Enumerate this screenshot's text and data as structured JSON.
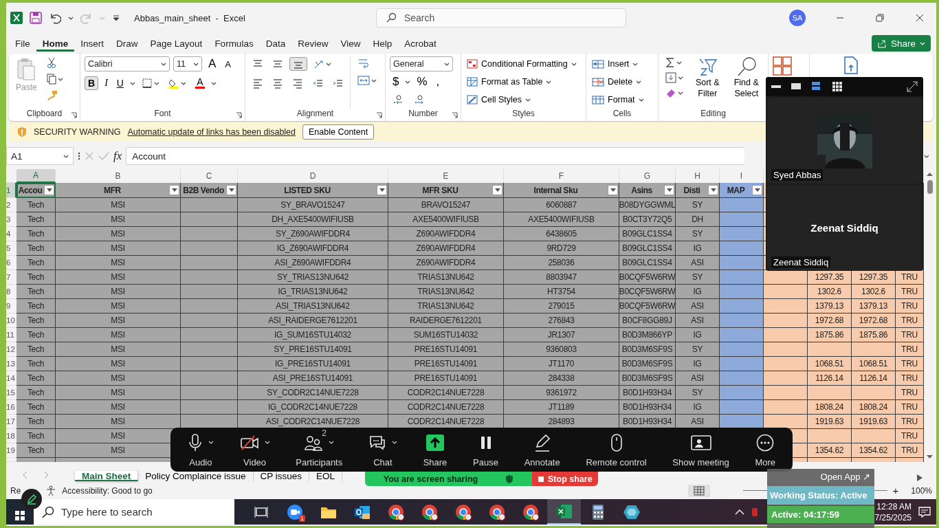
{
  "window": {
    "title": "Abbas_main_sheet  -  Excel",
    "search_placeholder": "Search",
    "user_initials": "SA"
  },
  "menu_tabs": [
    {
      "label": "File",
      "selected": false
    },
    {
      "label": "Home",
      "selected": true
    },
    {
      "label": "Insert",
      "selected": false
    },
    {
      "label": "Draw",
      "selected": false
    },
    {
      "label": "Page Layout",
      "selected": false
    },
    {
      "label": "Formulas",
      "selected": false
    },
    {
      "label": "Data",
      "selected": false
    },
    {
      "label": "Review",
      "selected": false
    },
    {
      "label": "View",
      "selected": false
    },
    {
      "label": "Help",
      "selected": false
    },
    {
      "label": "Acrobat",
      "selected": false
    }
  ],
  "share_button": {
    "label": "Share"
  },
  "ribbon": {
    "clipboard": {
      "label": "Clipboard",
      "paste": "Paste"
    },
    "font": {
      "label": "Font",
      "font_name": "Calibri",
      "font_size": "11",
      "grow": "A",
      "shrink": "A",
      "font_color": "A",
      "styles": [
        {
          "kind": "bold",
          "label": "B",
          "selected": true
        },
        {
          "kind": "italic",
          "label": "I",
          "selected": false
        },
        {
          "kind": "underline",
          "label": "U",
          "selected": false
        }
      ]
    },
    "alignment": {
      "label": "Alignment",
      "vertical": [
        {
          "kind": "top",
          "selected": false
        },
        {
          "kind": "middle",
          "selected": false
        },
        {
          "kind": "bottom",
          "selected": true
        }
      ]
    },
    "number": {
      "label": "Number",
      "format": "General",
      "symbols": [
        "$",
        "%",
        ","
      ]
    },
    "styles": {
      "label": "Styles",
      "items": [
        "Conditional Formatting",
        "Format as Table",
        "Cell Styles"
      ]
    },
    "cells": {
      "label": "Cells",
      "items": [
        "Insert",
        "Delete",
        "Format"
      ]
    },
    "editing": {
      "label": "Editing",
      "items": [
        "Sort & Filter",
        "Find & Select"
      ]
    }
  },
  "security_bar": {
    "title": "SECURITY WARNING",
    "message": "Automatic update of links has been disabled",
    "button": "Enable Content"
  },
  "formula_bar": {
    "cell_ref": "A1",
    "fx": "fx",
    "value": "Account"
  },
  "sheet": {
    "header_row": {
      "number": "1",
      "selected": true
    },
    "columns": [
      {
        "letter": "A",
        "header": "Accou",
        "color": "#a6a6a6",
        "filter": true,
        "selected": true
      },
      {
        "letter": "B",
        "header": "MFR",
        "color": "#a6a6a6",
        "filter": true,
        "selected": false
      },
      {
        "letter": "C",
        "header": "B2B Vendo",
        "color": "#a6a6a6",
        "filter": true,
        "selected": false
      },
      {
        "letter": "D",
        "header": "LISTED SKU",
        "color": "#a6a6a6",
        "filter": true,
        "selected": false
      },
      {
        "letter": "E",
        "header": "MFR SKU",
        "color": "#a6a6a6",
        "filter": true,
        "selected": false
      },
      {
        "letter": "F",
        "header": "Internal Sku",
        "color": "#a6a6a6",
        "filter": true,
        "selected": false
      },
      {
        "letter": "G",
        "header": "Asins",
        "color": "#a6a6a6",
        "filter": true,
        "selected": false
      },
      {
        "letter": "H",
        "header": "Disti",
        "color": "#a6a6a6",
        "filter": true,
        "selected": false
      },
      {
        "letter": "I",
        "header": "MAP",
        "color": "#8eaadb",
        "filter": true,
        "selected": false
      },
      {
        "color": "#f8cbad"
      },
      {
        "color": "#f8cbad"
      },
      {
        "color": "#f8cbad"
      },
      {
        "color": "#f8cbad"
      }
    ],
    "rows": [
      {
        "number": "2",
        "selected": false,
        "cells": [
          "Tech",
          "MSI",
          null,
          "SY_BRAVO15247",
          "BRAVO15247",
          "6060887",
          "B08DYGGWML",
          "SY",
          null,
          null,
          null,
          null,
          null
        ]
      },
      {
        "number": "3",
        "selected": false,
        "cells": [
          "Tech",
          "MSI",
          null,
          "DH_AXE5400WIFIUSB",
          "AXE5400WIFIUSB",
          "AXE5400WIFIUSB",
          "B0CT3Y72Q5",
          "DH",
          null,
          null,
          null,
          null,
          null
        ]
      },
      {
        "number": "4",
        "selected": false,
        "cells": [
          "Tech",
          "MSI",
          null,
          "SY_Z690AWIFDDR4",
          "Z690AWIFDDR4",
          "6438605",
          "B09GLC1SS4",
          "SY",
          null,
          null,
          null,
          null,
          null
        ]
      },
      {
        "number": "5",
        "selected": false,
        "cells": [
          "Tech",
          "MSI",
          null,
          "IG_Z690AWIFDDR4",
          "Z690AWIFDDR4",
          "9RD729",
          "B09GLC1SS4",
          "IG",
          null,
          null,
          null,
          null,
          null
        ]
      },
      {
        "number": "6",
        "selected": false,
        "cells": [
          "Tech",
          "MSI",
          null,
          "ASI_Z690AWIFDDR4",
          "Z690AWIFDDR4",
          "258036",
          "B09GLC1SS4",
          "ASI",
          null,
          null,
          null,
          null,
          null
        ]
      },
      {
        "number": "7",
        "selected": false,
        "cells": [
          "Tech",
          "MSI",
          null,
          "SY_TRIAS13NU642",
          "TRIAS13NU642",
          "8803947",
          "B0CQF5W6RW",
          "SY",
          null,
          null,
          "1297.35",
          "1297.35",
          "TRU"
        ]
      },
      {
        "number": "8",
        "selected": false,
        "cells": [
          "Tech",
          "MSI",
          null,
          "IG_TRIAS13NU642",
          "TRIAS13NU642",
          "HT3754",
          "B0CQF5W6RW",
          "IG",
          null,
          null,
          "1302.6",
          "1302.6",
          "TRU"
        ]
      },
      {
        "number": "9",
        "selected": false,
        "cells": [
          "Tech",
          "MSI",
          null,
          "ASI_TRIAS13NU642",
          "TRIAS13NU642",
          "279015",
          "B0CQF5W6RW",
          "ASI",
          null,
          null,
          "1379.13",
          "1379.13",
          "TRU"
        ]
      },
      {
        "number": "10",
        "selected": false,
        "cells": [
          "Tech",
          "MSI",
          null,
          "ASI_RAIDERGE7612201",
          "RAIDERGE7612201",
          "276843",
          "B0CF8GG89J",
          "ASI",
          null,
          null,
          "1972.68",
          "1972.68",
          "TRU"
        ]
      },
      {
        "number": "11",
        "selected": false,
        "cells": [
          "Tech",
          "MSI",
          null,
          "IG_SUM16STU14032",
          "SUM16STU14032",
          "JR1307",
          "B0D3M866YP",
          "IG",
          null,
          null,
          "1875.86",
          "1875.86",
          "TRU"
        ]
      },
      {
        "number": "12",
        "selected": false,
        "cells": [
          "Tech",
          "MSI",
          null,
          "SY_PRE16STU14091",
          "PRE16STU14091",
          "9360803",
          "B0D3M6SF9S",
          "SY",
          null,
          null,
          null,
          null,
          "TRU"
        ]
      },
      {
        "number": "13",
        "selected": false,
        "cells": [
          "Tech",
          "MSI",
          null,
          "IG_PRE16STU14091",
          "PRE16STU14091",
          "JT1170",
          "B0D3M6SF9S",
          "IG",
          null,
          null,
          "1068.51",
          "1068.51",
          "TRU"
        ]
      },
      {
        "number": "14",
        "selected": false,
        "cells": [
          "Tech",
          "MSI",
          null,
          "ASI_PRE16STU14091",
          "PRE16STU14091",
          "284338",
          "B0D3M6SF9S",
          "ASI",
          null,
          null,
          "1126.14",
          "1126.14",
          "TRU"
        ]
      },
      {
        "number": "15",
        "selected": false,
        "cells": [
          "Tech",
          "MSI",
          null,
          "SY_CODR2C14NUE7228",
          "CODR2C14NUE7228",
          "9361972",
          "B0D1H93H34",
          "SY",
          null,
          null,
          null,
          null,
          "TRU"
        ]
      },
      {
        "number": "16",
        "selected": false,
        "cells": [
          "Tech",
          "MSI",
          null,
          "IG_CODR2C14NUE7228",
          "CODR2C14NUE7228",
          "JT1189",
          "B0D1H93H34",
          "IG",
          null,
          null,
          "1808.24",
          "1808.24",
          "TRU"
        ]
      },
      {
        "number": "17",
        "selected": false,
        "cells": [
          "Tech",
          "MSI",
          null,
          "ASI_CODR2C14NUE7228",
          "CODR2C14NUE7228",
          "284893",
          "B0D1H93H34",
          "ASI",
          null,
          null,
          "1919.63",
          "1919.63",
          "TRU"
        ]
      },
      {
        "number": "18",
        "selected": false,
        "cells": [
          "Tech",
          "MSI",
          null,
          null,
          null,
          null,
          null,
          null,
          null,
          null,
          null,
          null,
          "TRU"
        ]
      },
      {
        "number": "19",
        "selected": false,
        "cells": [
          "Tech",
          "MSI",
          null,
          null,
          null,
          null,
          null,
          null,
          null,
          null,
          "1354.62",
          "1354.62",
          "TRU"
        ]
      }
    ]
  },
  "sheet_tabs": [
    {
      "label": "Main Sheet",
      "selected": true
    },
    {
      "label": "Policy Complaince issue",
      "selected": false
    },
    {
      "label": "CP issues",
      "selected": false
    },
    {
      "label": "EOL",
      "selected": false
    }
  ],
  "status_bar": {
    "status": "Re",
    "accessibility": "Accessibility: Good to go",
    "zoom_plus": "+",
    "zoom": "100%",
    "views": [
      {
        "kind": "normal",
        "selected": true
      }
    ]
  },
  "meeting_panel": {
    "views": [
      {
        "kind": "minimize",
        "selected": false
      },
      {
        "kind": "thumbnail",
        "selected": false
      },
      {
        "kind": "speaker",
        "selected": true
      },
      {
        "kind": "gallery",
        "selected": false
      }
    ],
    "participants": [
      {
        "kind": "picture",
        "name": "Syed Abbas"
      },
      {
        "kind": "name",
        "display_name": "Zeenat Siddiq",
        "name": "Zeenat Siddiq"
      }
    ]
  },
  "meeting_toolbar": [
    {
      "kind": "audio",
      "label": "Audio",
      "caret": true,
      "muted": false
    },
    {
      "kind": "video",
      "label": "Video",
      "caret": true,
      "muted": true
    },
    {
      "kind": "participants",
      "label": "Participants",
      "caret": true,
      "badge": "2"
    },
    {
      "kind": "chat",
      "label": "Chat",
      "caret": true
    },
    {
      "kind": "share",
      "label": "Share"
    },
    {
      "kind": "pause",
      "label": "Pause"
    },
    {
      "kind": "annotate",
      "label": "Annotate"
    },
    {
      "kind": "remote",
      "label": "Remote control"
    },
    {
      "kind": "show",
      "label": "Show meeting"
    },
    {
      "kind": "more",
      "label": "More"
    }
  ],
  "sharing_bar": {
    "message": "You are screen sharing",
    "stop": "Stop share"
  },
  "tracker": {
    "open_app": "Open App ↗",
    "working_status": "Working Status: Active",
    "active_time": "Active: 04:17:59"
  },
  "taskbar": {
    "search_placeholder": "Type here to search",
    "apps": [
      {
        "kind": "taskview",
        "selected": false
      },
      {
        "kind": "zoom",
        "badge": "1",
        "selected": false
      },
      {
        "kind": "folder",
        "selected": false
      },
      {
        "kind": "outlook",
        "selected": false
      },
      {
        "kind": "chrome",
        "selected": false
      },
      {
        "kind": "chrome",
        "selected": false
      },
      {
        "kind": "chrome",
        "selected": false
      },
      {
        "kind": "chrome",
        "selected": false
      },
      {
        "kind": "chrome",
        "selected": false
      },
      {
        "kind": "excel",
        "selected": true
      },
      {
        "kind": "calculator",
        "selected": false
      },
      {
        "kind": "hex",
        "selected": false
      }
    ],
    "time": "12:28 AM",
    "date": "7/25/2025"
  }
}
